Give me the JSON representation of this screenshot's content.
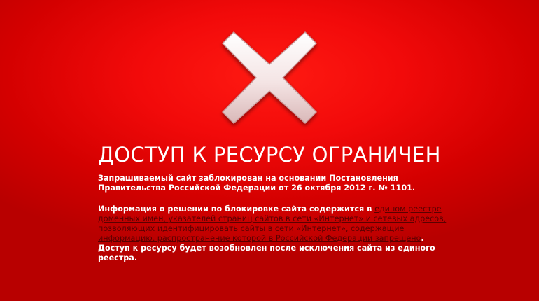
{
  "page": {
    "background_color": "#e60000",
    "icon": "close-x-icon",
    "title": "ДОСТУП К РЕСУРСУ ОГРАНИЧЕН",
    "paragraph1": "Запрашиваемый сайт заблокирован на основании Постановления Правительства Российской Федерации от 26 октября 2012 г. № 1101.",
    "paragraph2_prefix": "Информация о решении по блокировке сайта содержится в ",
    "registry_link": "едином реестре доменных имен, указателей страниц сайтов в сети «Интернет» и сетевых адресов, позволяющих идентифицировать сайты в сети «Интернет», содержащие информацию, распространение которой в Российской Федерации запрещено",
    "paragraph2_suffix": ".",
    "paragraph3": "Доступ к ресурсу будет возобновлен после исключения сайта из единого реестра.",
    "link_color": "#5a0000"
  }
}
